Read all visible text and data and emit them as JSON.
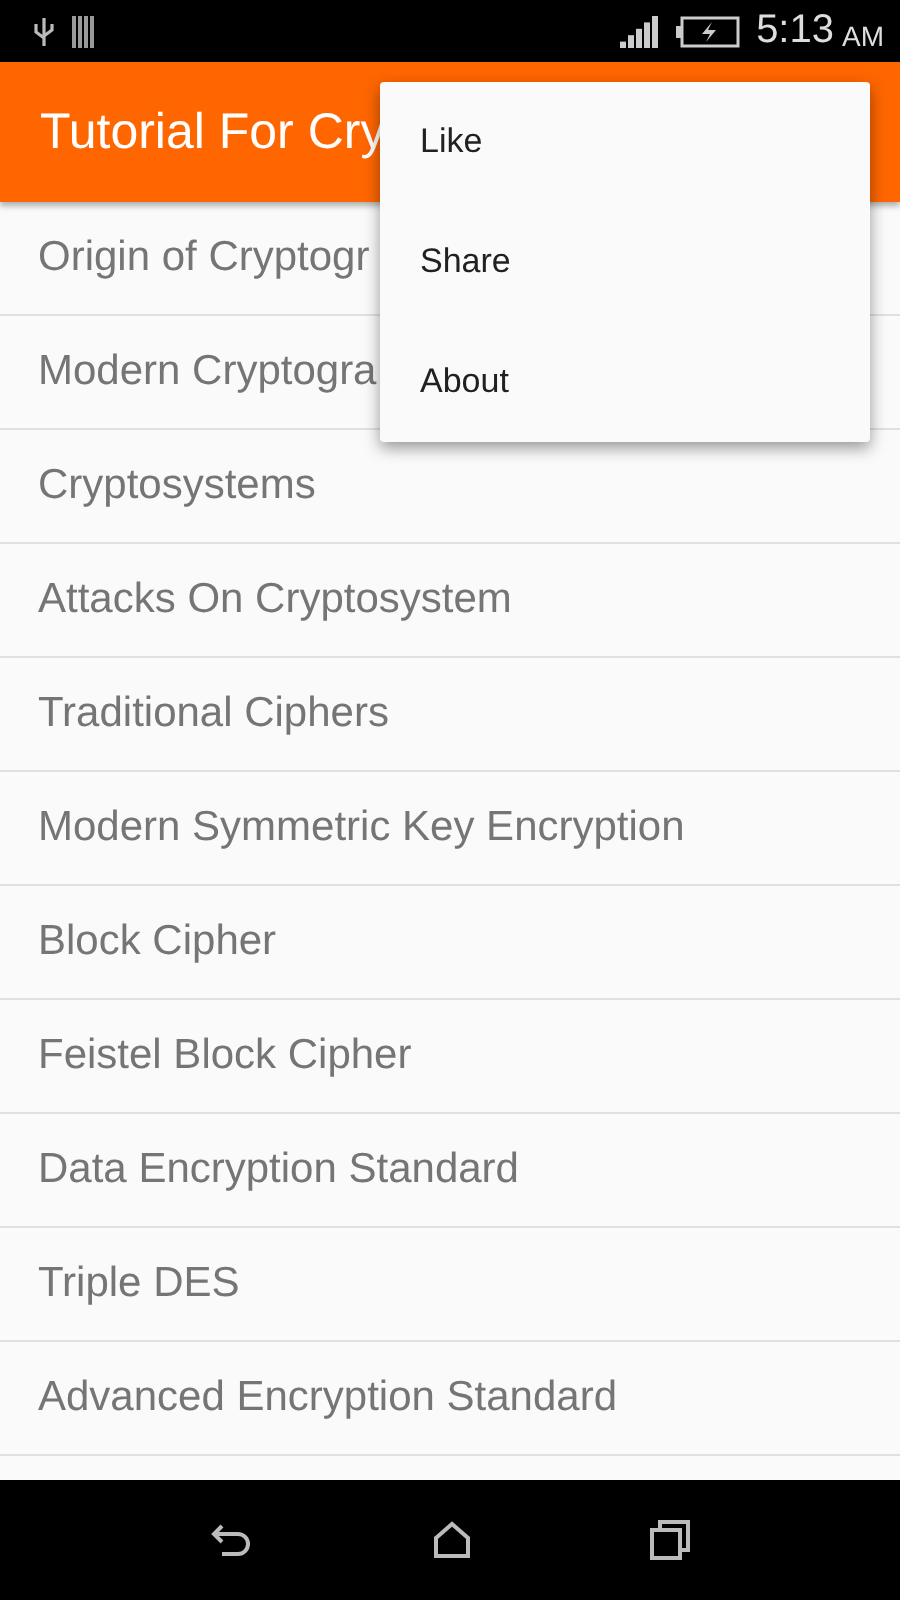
{
  "status_bar": {
    "time": "5:13",
    "ampm": "AM"
  },
  "app_bar": {
    "title": "Tutorial For Cry"
  },
  "list": [
    "Origin of Cryptogr",
    "Modern Cryptogra",
    "Cryptosystems",
    "Attacks On Cryptosystem",
    "Traditional Ciphers",
    "Modern Symmetric Key Encryption",
    "Block Cipher",
    "Feistel Block Cipher",
    "Data Encryption Standard",
    "Triple DES",
    "Advanced Encryption Standard"
  ],
  "menu": [
    "Like",
    "Share",
    "About"
  ]
}
